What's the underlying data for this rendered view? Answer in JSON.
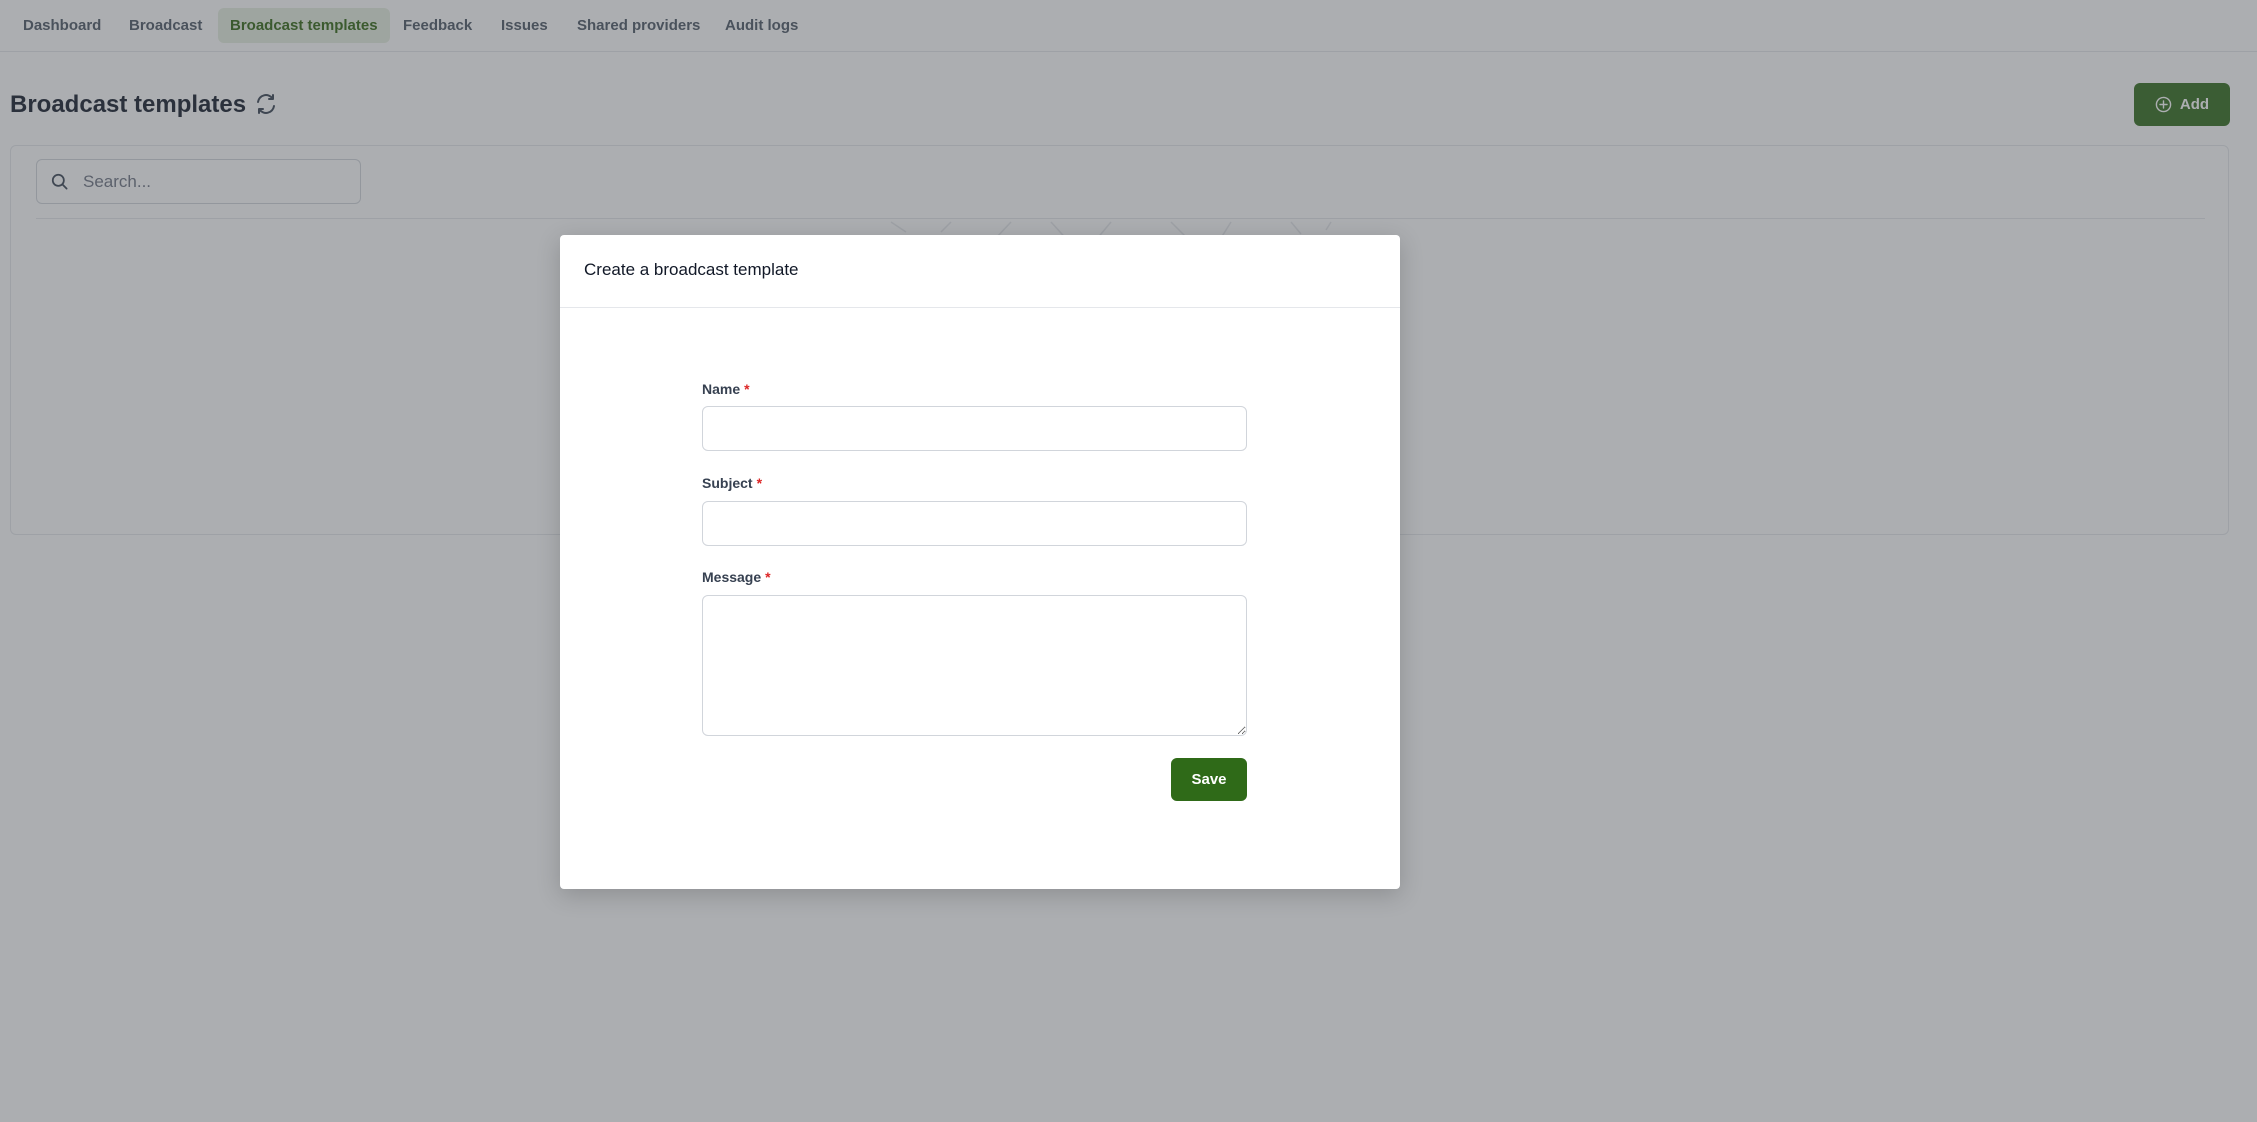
{
  "nav": {
    "items": [
      {
        "label": "Dashboard",
        "active": false
      },
      {
        "label": "Broadcast",
        "active": false
      },
      {
        "label": "Broadcast templates",
        "active": true
      },
      {
        "label": "Feedback",
        "active": false
      },
      {
        "label": "Issues",
        "active": false
      },
      {
        "label": "Shared providers",
        "active": false
      },
      {
        "label": "Audit logs",
        "active": false
      }
    ]
  },
  "page": {
    "title": "Broadcast templates",
    "refresh_icon": "refresh-icon",
    "add_button": {
      "label": "Add",
      "icon": "plus-circle-icon"
    }
  },
  "list": {
    "search": {
      "placeholder": "Search...",
      "value": "",
      "icon": "search-icon"
    }
  },
  "modal": {
    "title": "Create a broadcast template",
    "fields": {
      "name": {
        "label": "Name",
        "required_mark": "*",
        "value": ""
      },
      "subject": {
        "label": "Subject",
        "required_mark": "*",
        "value": ""
      },
      "message": {
        "label": "Message",
        "required_mark": "*",
        "value": ""
      }
    },
    "save_label": "Save"
  },
  "colors": {
    "accent": "#2f6a18",
    "active_nav_bg": "#e6efdf",
    "active_nav_text": "#2f6410",
    "required": "#dc2626",
    "overlay": "rgba(75, 79, 86, 0.46)"
  }
}
